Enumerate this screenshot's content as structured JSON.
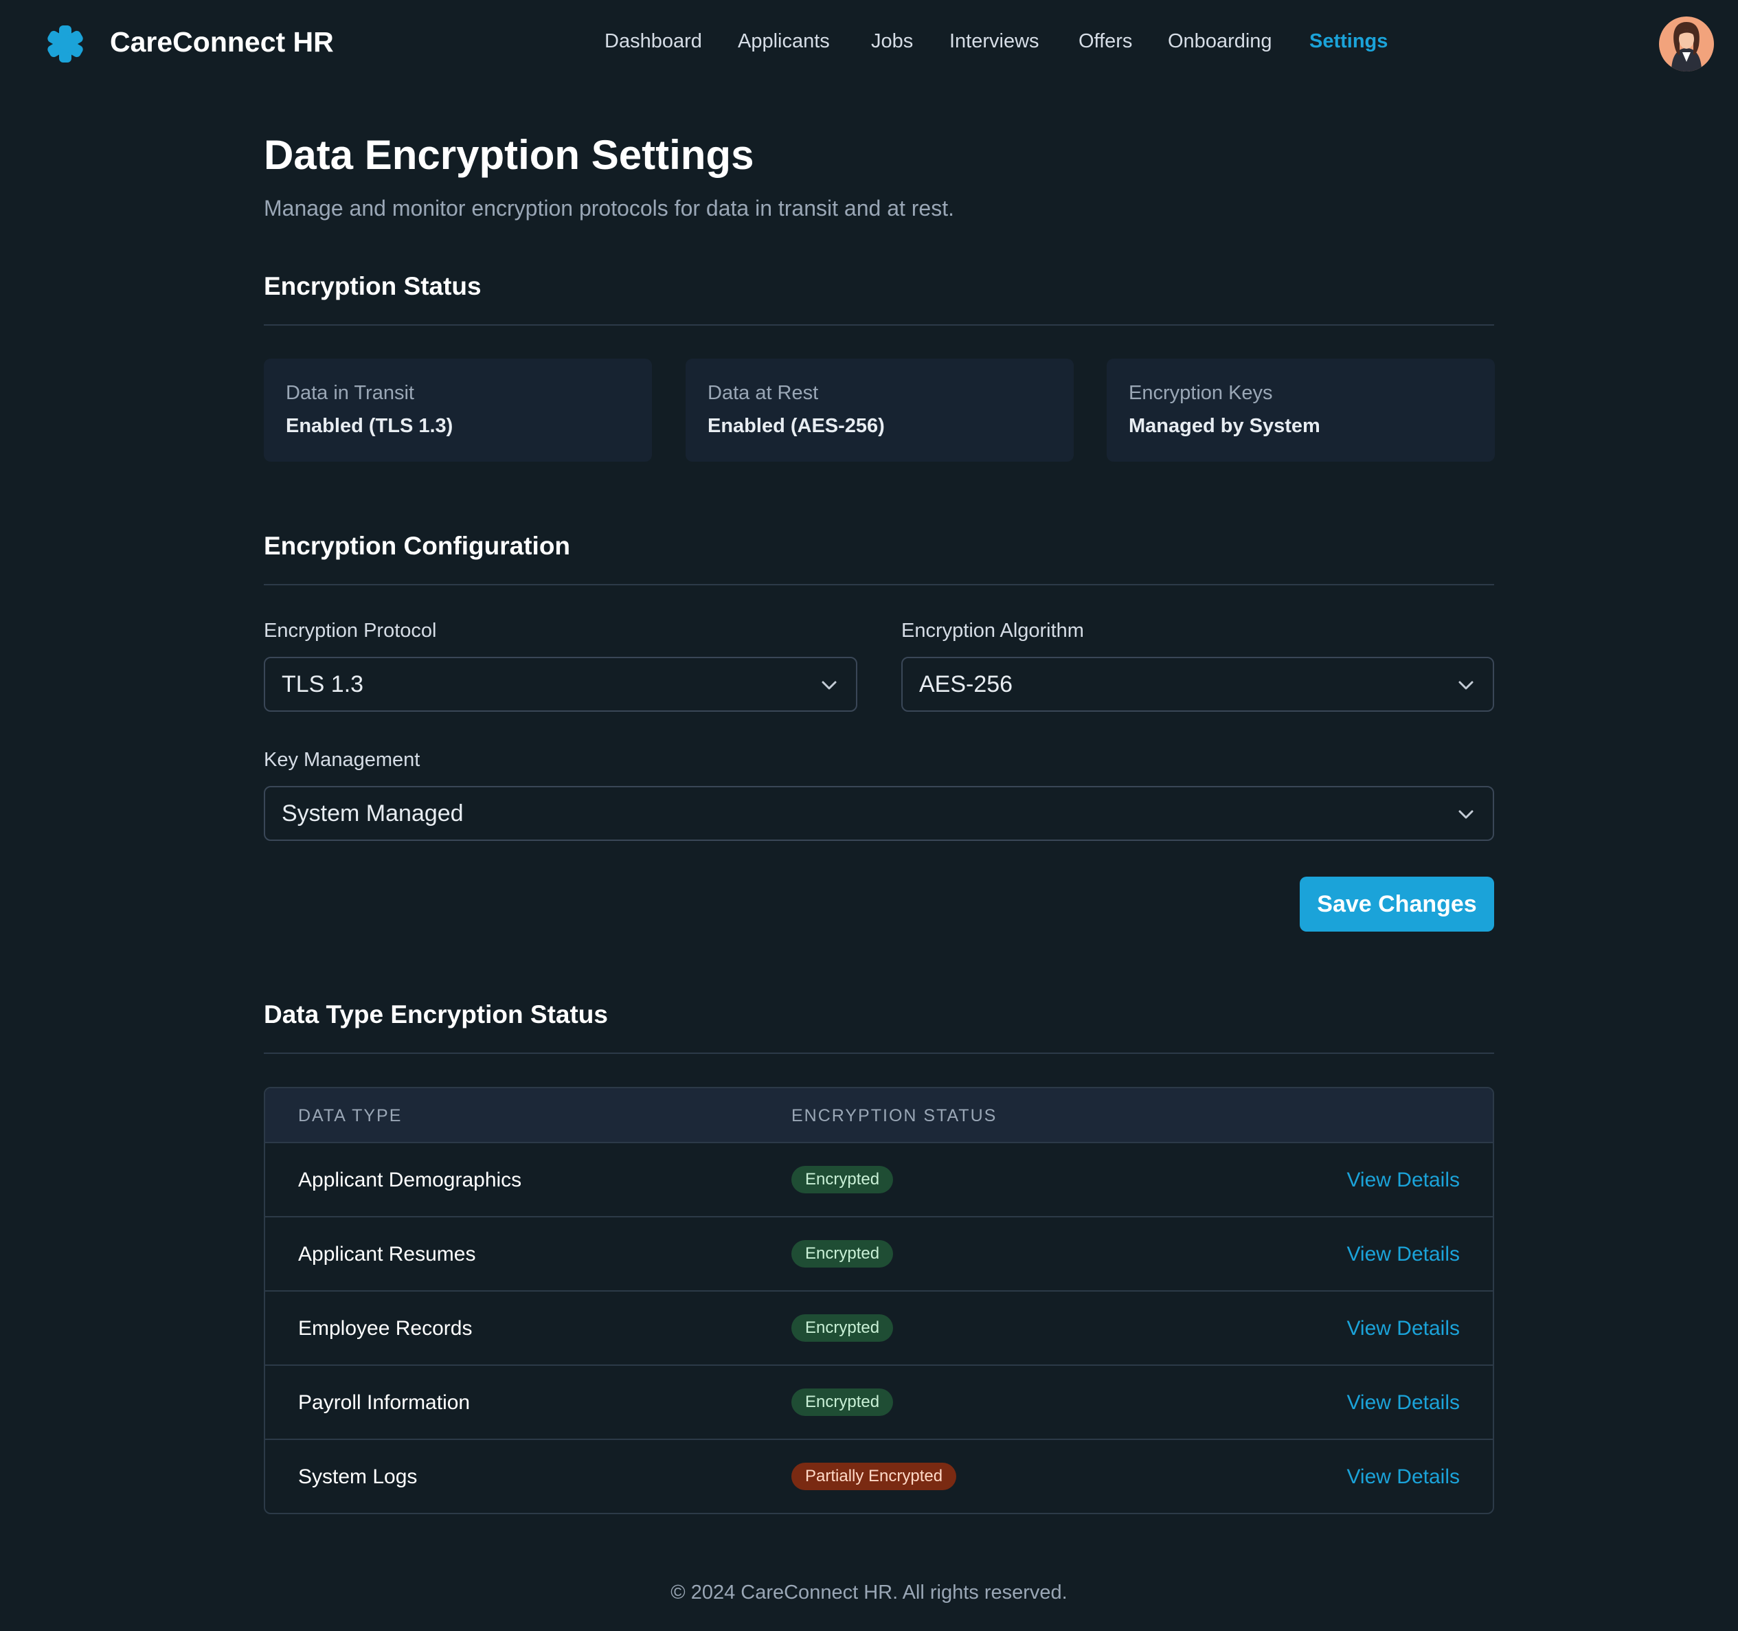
{
  "header": {
    "brand": "CareConnect HR",
    "brand_color": "#1ba3d9",
    "logo_icon": "medical-asterisk-icon",
    "nav": [
      {
        "label": "Dashboard",
        "active": false
      },
      {
        "label": "Applicants",
        "active": false
      },
      {
        "label": "Jobs",
        "active": false
      },
      {
        "label": "Interviews",
        "active": false
      },
      {
        "label": "Offers",
        "active": false
      },
      {
        "label": "Onboarding",
        "active": false
      },
      {
        "label": "Settings",
        "active": true
      }
    ],
    "avatar_icon": "user-avatar"
  },
  "page": {
    "title": "Data Encryption Settings",
    "subtitle": "Manage and monitor encryption protocols for data in transit and at rest."
  },
  "encryption_status": {
    "section_title": "Encryption Status",
    "cards": [
      {
        "label": "Data in Transit",
        "value": "Enabled (TLS 1.3)"
      },
      {
        "label": "Data at Rest",
        "value": "Enabled (AES-256)"
      },
      {
        "label": "Encryption Keys",
        "value": "Managed by System"
      }
    ]
  },
  "configuration": {
    "section_title": "Encryption Configuration",
    "protocol": {
      "label": "Encryption Protocol",
      "value": "TLS 1.3"
    },
    "algorithm": {
      "label": "Encryption Algorithm",
      "value": "AES-256"
    },
    "key_management": {
      "label": "Key Management",
      "value": "System Managed"
    },
    "save_label": "Save Changes"
  },
  "data_types": {
    "section_title": "Data Type Encryption Status",
    "columns": [
      "DATA TYPE",
      "ENCRYPTION STATUS"
    ],
    "rows": [
      {
        "type": "Applicant Demographics",
        "status": "Encrypted",
        "status_kind": "ok",
        "action": "View Details"
      },
      {
        "type": "Applicant Resumes",
        "status": "Encrypted",
        "status_kind": "ok",
        "action": "View Details"
      },
      {
        "type": "Employee Records",
        "status": "Encrypted",
        "status_kind": "ok",
        "action": "View Details"
      },
      {
        "type": "Payroll Information",
        "status": "Encrypted",
        "status_kind": "ok",
        "action": "View Details"
      },
      {
        "type": "System Logs",
        "status": "Partially Encrypted",
        "status_kind": "partial",
        "action": "View Details"
      }
    ]
  },
  "footer": {
    "text": "© 2024 CareConnect HR. All rights reserved."
  }
}
